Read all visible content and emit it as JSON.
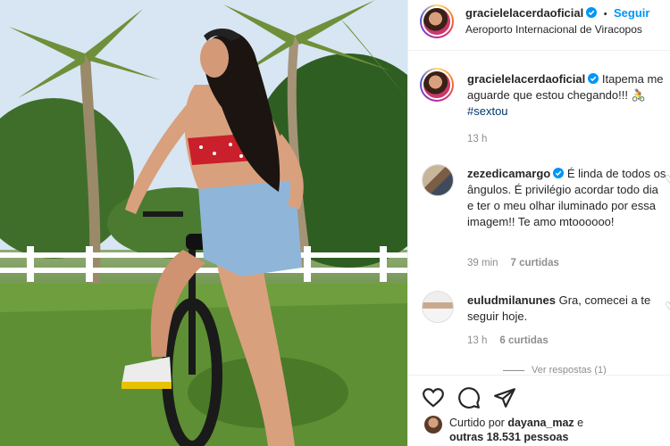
{
  "post": {
    "author": "gracielelacerdaoficial",
    "follow_label": "Seguir",
    "separator": "•",
    "location": "Aeroporto Internacional de Viracopos"
  },
  "caption": {
    "username": "gracielelacerdaoficial",
    "text": "Itapema me aguarde que estou chegando!!! 🚴",
    "hashtag": "#sextou",
    "time": "13 h"
  },
  "comments": [
    {
      "username": "zezedicamargo",
      "verified": true,
      "text": "É linda de todos os ângulos. É privilégio acordar todo dia e ter o meu olhar iluminado por essa imagem!! Te amo mtoooooo!",
      "time": "39 min",
      "likes": "7 curtidas"
    },
    {
      "username": "euludmilanunes",
      "verified": false,
      "text": "Gra, comecei a te seguir hoje.",
      "time": "13 h",
      "likes": "6 curtidas"
    }
  ],
  "view_replies": "Ver respostas (1)",
  "likes_summary": {
    "prefix": "Curtido por",
    "user": "dayana_maz",
    "conj": "e",
    "others": "outras 18.531 pessoas"
  },
  "icons": {
    "like": "heart-icon",
    "comment": "comment-bubble-icon",
    "share": "paper-plane-icon",
    "verified": "verified-badge-icon"
  },
  "colors": {
    "link_blue": "#0095f6",
    "verified_blue": "#0095f6",
    "muted": "#8e8e8e",
    "text": "#262626"
  }
}
